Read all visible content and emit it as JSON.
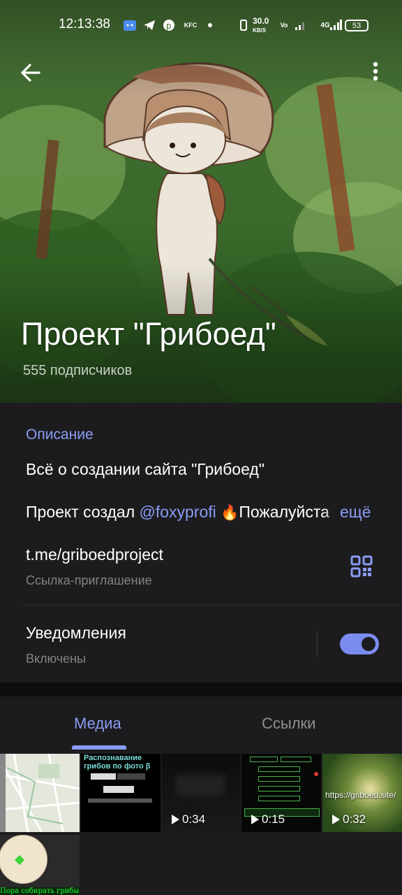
{
  "status_bar": {
    "time": "12:13:38",
    "net_speed": "30.0",
    "net_unit": "KB/S",
    "network": "4G",
    "battery": "53"
  },
  "header": {
    "title": "Проект \"Грибоед\"",
    "subscribers": "555 подписчиков"
  },
  "info": {
    "description_label": "Описание",
    "description_line1": "Всё о создании сайта \"Грибоед\"",
    "description_prefix": "Проект создал ",
    "description_mention": "@foxyprofi",
    "description_emoji": "🔥",
    "description_rest": "Пожалуйста",
    "more_label": "ещё",
    "link": "t.me/griboedproject",
    "link_sub": "Ссылка-приглашение",
    "notifications_label": "Уведомления",
    "notifications_sub": "Включены",
    "notifications_on": true
  },
  "tabs": {
    "media": "Медиа",
    "links": "Ссылки"
  },
  "media": {
    "items": [
      {
        "type": "image",
        "icon": "map-thumbnail"
      },
      {
        "type": "image",
        "title": "Распознавание грибов по фото β"
      },
      {
        "type": "video",
        "duration": "0:34"
      },
      {
        "type": "video",
        "duration": "0:15"
      },
      {
        "type": "video",
        "duration": "0:32",
        "label": "https://griboed.site/"
      }
    ],
    "bottom_caption": "Пора собирать грибы! Из"
  },
  "colors": {
    "accent": "#8a9cf5",
    "background": "#1c1c1e",
    "toggle": "#7b8cf0"
  }
}
